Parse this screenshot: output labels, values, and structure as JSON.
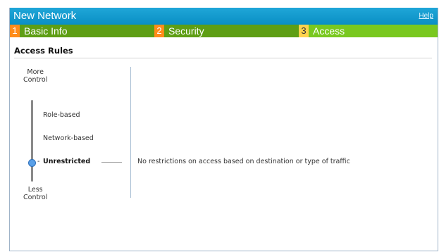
{
  "window": {
    "title": "New Network",
    "help_label": "Help"
  },
  "tabs": [
    {
      "number": "1",
      "label": "Basic Info"
    },
    {
      "number": "2",
      "label": "Security"
    },
    {
      "number": "3",
      "label": "Access"
    }
  ],
  "section": {
    "title": "Access Rules"
  },
  "slider": {
    "top_label": "More\nControl",
    "bottom_label": "Less\nControl",
    "options": [
      "Role-based",
      "Network-based",
      "Unrestricted"
    ],
    "selected": "Unrestricted",
    "dash": "-"
  },
  "description": "No restrictions on access based on destination or type of traffic",
  "colors": {
    "titlebar": "#0a8fc4",
    "tab_inactive": "#5e9e14",
    "tab_active": "#79c81f",
    "tab_number_orange": "#ff8c1a",
    "tab_number_active": "#ffd34d",
    "slider_thumb": "#5aa0e8"
  }
}
